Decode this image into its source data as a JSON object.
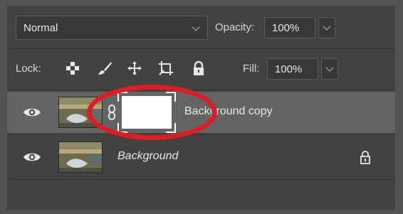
{
  "blend": {
    "mode": "Normal",
    "opacity_label": "Opacity:",
    "opacity_value": "100%"
  },
  "lock": {
    "label": "Lock:",
    "icons": [
      "lock-transparent-pixels-icon",
      "lock-image-pixels-icon",
      "lock-position-icon",
      "lock-artboard-icon",
      "lock-all-icon"
    ],
    "fill_label": "Fill:",
    "fill_value": "100%"
  },
  "layers": [
    {
      "name": "Background copy",
      "italic": false,
      "selected": true,
      "has_mask": true,
      "visible": true,
      "locked": false
    },
    {
      "name": "Background",
      "italic": true,
      "selected": false,
      "has_mask": false,
      "visible": true,
      "locked": true
    }
  ],
  "annotation": {
    "color": "#dc1d25",
    "shape": "ellipse"
  },
  "colors": {
    "panel": "#424242",
    "selected_row": "#646464",
    "field": "#383838"
  }
}
